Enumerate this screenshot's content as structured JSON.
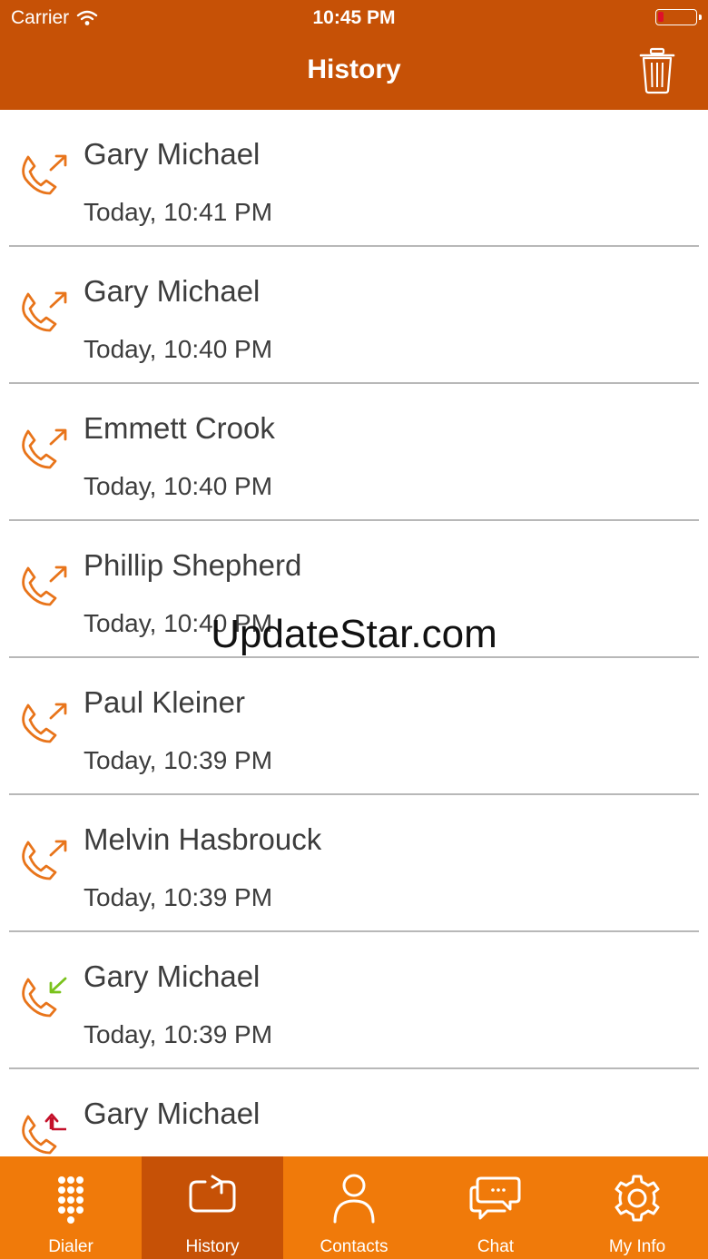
{
  "status_bar": {
    "carrier": "Carrier",
    "time": "10:45 PM"
  },
  "header": {
    "title": "History",
    "background_color": "#c65106"
  },
  "call_history": [
    {
      "name": "Gary Michael",
      "time": "Today, 10:41 PM",
      "direction": "outgoing"
    },
    {
      "name": "Gary Michael",
      "time": "Today, 10:40 PM",
      "direction": "outgoing"
    },
    {
      "name": "Emmett Crook",
      "time": "Today, 10:40 PM",
      "direction": "outgoing"
    },
    {
      "name": "Phillip Shepherd",
      "time": "Today, 10:40 PM",
      "direction": "outgoing"
    },
    {
      "name": "Paul Kleiner",
      "time": "Today, 10:39 PM",
      "direction": "outgoing"
    },
    {
      "name": "Melvin Hasbrouck",
      "time": "Today, 10:39 PM",
      "direction": "outgoing"
    },
    {
      "name": "Gary Michael",
      "time": "Today, 10:39 PM",
      "direction": "incoming"
    },
    {
      "name": "Gary Michael",
      "time": "",
      "direction": "missed"
    }
  ],
  "watermark": "UpdateStar.com",
  "tabs": [
    {
      "label": "Dialer",
      "icon": "dialpad-icon"
    },
    {
      "label": "History",
      "icon": "history-icon",
      "active": true
    },
    {
      "label": "Contacts",
      "icon": "person-icon"
    },
    {
      "label": "Chat",
      "icon": "chat-icon"
    },
    {
      "label": "My Info",
      "icon": "gear-icon"
    }
  ],
  "colors": {
    "accent": "#f07a0a",
    "outgoing_arrow": "#e8741a",
    "incoming_arrow": "#7ac21c",
    "missed_arrow": "#c4102a"
  }
}
